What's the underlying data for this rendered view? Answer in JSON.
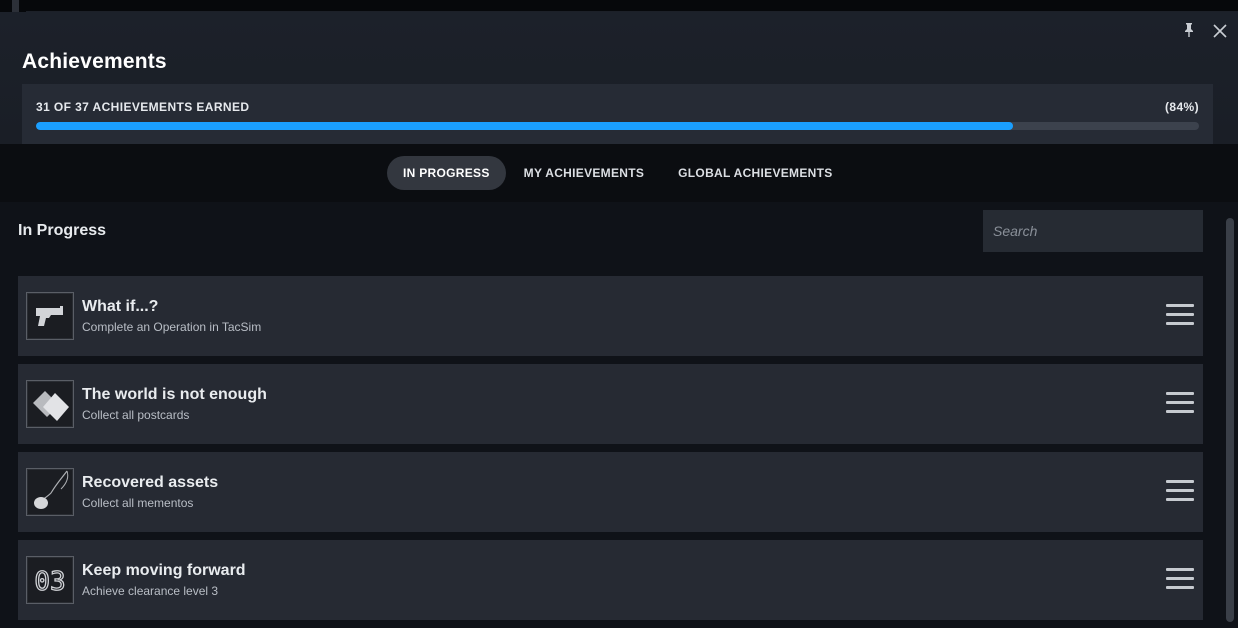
{
  "header": {
    "title": "Achievements",
    "progress_label": "31 OF 37 ACHIEVEMENTS EARNED",
    "progress_percent_text": "(84%)",
    "progress_fraction": 0.84
  },
  "tabs": [
    {
      "label": "IN PROGRESS",
      "active": true
    },
    {
      "label": "MY ACHIEVEMENTS",
      "active": false
    },
    {
      "label": "GLOBAL ACHIEVEMENTS",
      "active": false
    }
  ],
  "content": {
    "section_title": "In Progress",
    "search_placeholder": "Search"
  },
  "achievements": [
    {
      "name": "What if...?",
      "description": "Complete an Operation in TacSim",
      "icon": "pistol-icon"
    },
    {
      "name": "The world is not enough",
      "description": "Collect all postcards",
      "icon": "postcards-icon"
    },
    {
      "name": "Recovered assets",
      "description": "Collect all mementos",
      "icon": "pendant-icon"
    },
    {
      "name": "Keep moving forward",
      "description": "Achieve clearance level 3",
      "icon": "clearance-03-icon",
      "icon_text": "03"
    }
  ],
  "colors": {
    "accent": "#1a9fff",
    "background": "#0f1218",
    "panel": "#262a33"
  }
}
